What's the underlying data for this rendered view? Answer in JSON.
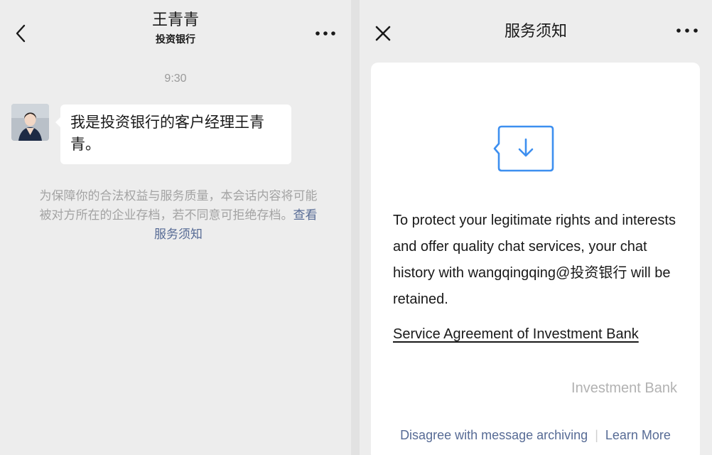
{
  "chat": {
    "title": "王青青",
    "subtitle": "投资银行",
    "timestamp": "9:30",
    "message": "我是投资银行的客户经理王青青。",
    "notice_text": "为保障你的合法权益与服务质量，本会话内容将可能被对方所在的企业存档，若不同意可拒绝存档。",
    "notice_link": "查看服务须知",
    "icons": {
      "back": "chevron-left-icon",
      "more": "more-dots-icon"
    }
  },
  "service_notice": {
    "title": "服务须知",
    "body": "To protect your legitimate rights and interests and offer quality chat services, your chat history with wangqingqing@投资银行 will be retained.",
    "agreement_link": "Service Agreement of Investment Bank",
    "signature": "Investment Bank",
    "disagree_link": "Disagree with message archiving",
    "separator": "|",
    "learn_more_link": "Learn More",
    "icons": {
      "close": "close-icon",
      "more": "more-dots-icon",
      "illustration": "download-icon"
    }
  },
  "colors": {
    "link": "#576b95",
    "accent_blue": "#3d8ff0",
    "background": "#ededed",
    "muted_text": "#a3a3a3"
  }
}
